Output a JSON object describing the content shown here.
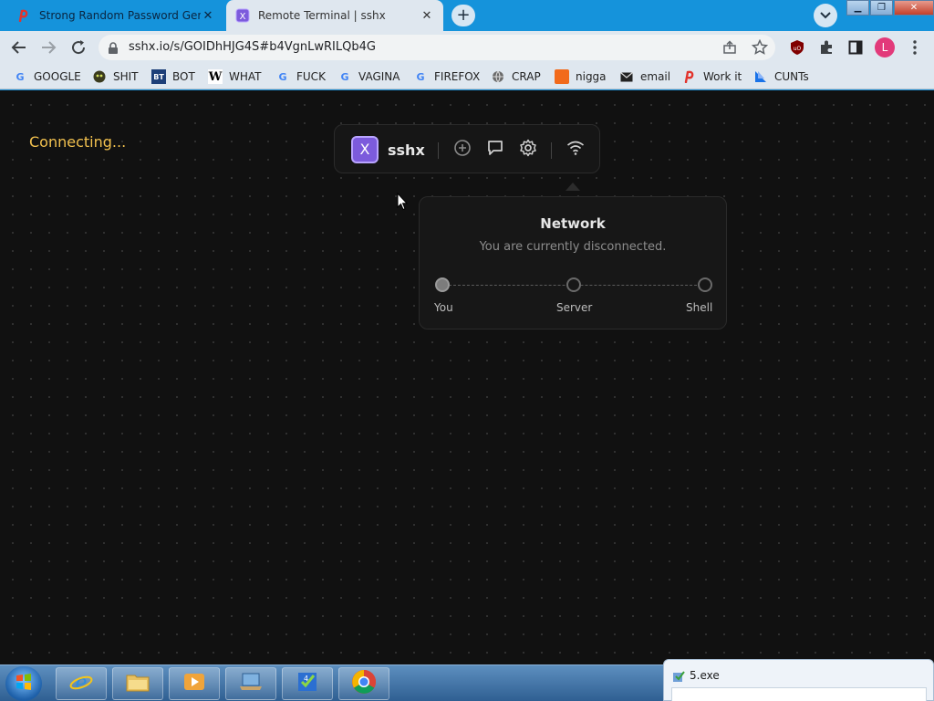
{
  "tabs": [
    {
      "title": "Strong Random Password Generator",
      "favicon": "passwords-logo-icon",
      "active": false
    },
    {
      "title": "Remote Terminal | sshx",
      "favicon": "sshx-logo-icon",
      "active": true
    }
  ],
  "toolbar": {
    "url": "sshx.io/s/GOIDhHJG4S#b4VgnLwRILQb4G",
    "avatar_letter": "L"
  },
  "bookmarks": [
    {
      "label": "GOOGLE",
      "icon": "google-icon"
    },
    {
      "label": "SHIT",
      "icon": "bot-icon"
    },
    {
      "label": "BOT",
      "icon": "bt-icon"
    },
    {
      "label": "WHAT",
      "icon": "w-icon"
    },
    {
      "label": "FUCK",
      "icon": "google-icon"
    },
    {
      "label": "VAGINA",
      "icon": "google-icon"
    },
    {
      "label": "FIREFOX",
      "icon": "google-icon"
    },
    {
      "label": "CRAP",
      "icon": "globe-icon"
    },
    {
      "label": "nigga",
      "icon": "soundcloud-icon"
    },
    {
      "label": "email",
      "icon": "mail-icon"
    },
    {
      "label": "Work it",
      "icon": "passwords-logo-icon"
    },
    {
      "label": "CUNTs",
      "icon": "flag-icon"
    }
  ],
  "page": {
    "status": "Connecting...",
    "app_name": "sshx",
    "logo_letter": "X"
  },
  "network": {
    "title": "Network",
    "subtitle": "You are currently disconnected.",
    "nodes": [
      "You",
      "Server",
      "Shell"
    ]
  },
  "taskbar": {
    "popup_title": "5.exe"
  }
}
